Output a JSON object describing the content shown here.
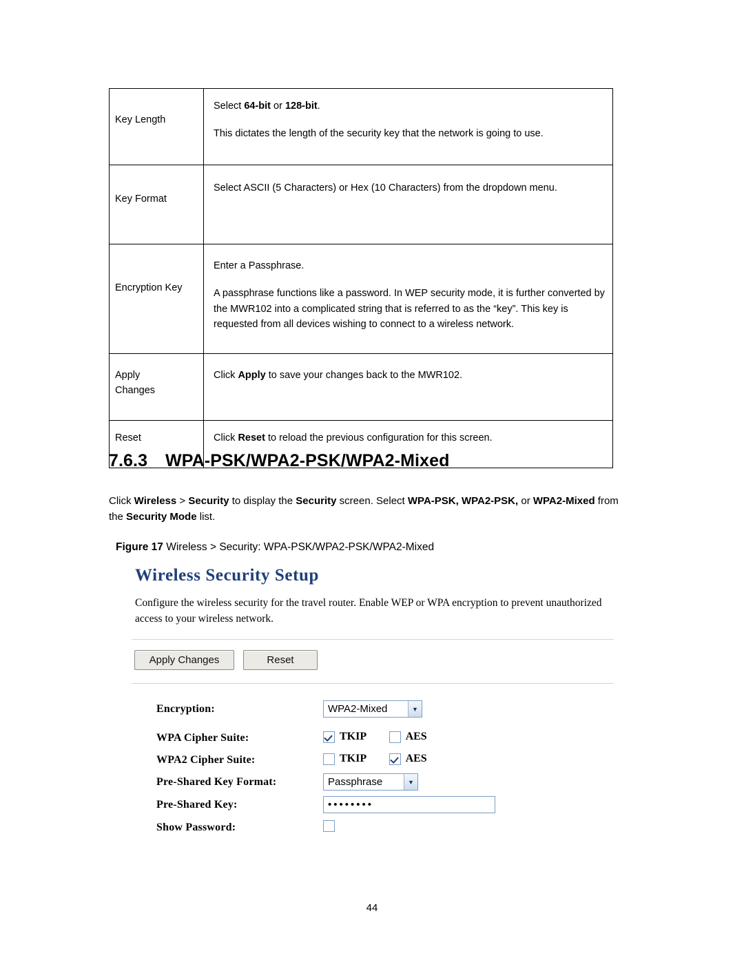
{
  "table": {
    "rows": [
      {
        "label": "Key Length",
        "lines": [
          {
            "segments": [
              {
                "t": "Select ",
                "b": false
              },
              {
                "t": "64-bit",
                "b": true
              },
              {
                "t": " or ",
                "b": false
              },
              {
                "t": "128-bit",
                "b": true
              },
              {
                "t": ".",
                "b": false
              }
            ]
          },
          {
            "segments": [
              {
                "t": "This dictates the length of the security key that the network is going to use.",
                "b": false
              }
            ]
          }
        ]
      },
      {
        "label": "Key Format",
        "lines": [
          {
            "segments": [
              {
                "t": "Select ASCII (5 Characters) or Hex (10 Characters) from the dropdown menu.",
                "b": false
              }
            ]
          }
        ]
      },
      {
        "label": "Encryption Key",
        "lines": [
          {
            "segments": [
              {
                "t": "Enter a Passphrase.",
                "b": false
              }
            ]
          },
          {
            "segments": [
              {
                "t": "A passphrase functions like a password. In WEP security mode, it is further converted by the MWR102 into a complicated string that is referred to as the “key”. This key is requested from all devices wishing to connect to a wireless network.",
                "b": false
              }
            ]
          }
        ]
      },
      {
        "label": "Apply Changes",
        "lines": [
          {
            "segments": [
              {
                "t": "Click ",
                "b": false
              },
              {
                "t": "Apply",
                "b": true
              },
              {
                "t": " to save your changes back to the MWR102.",
                "b": false
              }
            ]
          }
        ]
      },
      {
        "label": "Reset",
        "lines": [
          {
            "segments": [
              {
                "t": "Click ",
                "b": false
              },
              {
                "t": "Reset",
                "b": true
              },
              {
                "t": " to reload the previous configuration for this screen.",
                "b": false
              }
            ]
          }
        ]
      }
    ]
  },
  "heading": {
    "number": "7.6.3",
    "text": "WPA-PSK/WPA2-PSK/WPA2-Mixed"
  },
  "paragraph": {
    "segments": [
      {
        "t": "Click ",
        "b": false
      },
      {
        "t": "Wireless",
        "b": true
      },
      {
        "t": " > ",
        "b": false
      },
      {
        "t": "Security",
        "b": true
      },
      {
        "t": " to display the ",
        "b": false
      },
      {
        "t": "Security",
        "b": true
      },
      {
        "t": " screen. Select ",
        "b": false
      },
      {
        "t": "WPA-PSK, WPA2-PSK,",
        "b": true
      },
      {
        "t": " or ",
        "b": false
      },
      {
        "t": "WPA2-Mixed",
        "b": true
      },
      {
        "t": " from the ",
        "b": false
      },
      {
        "t": "Security Mode",
        "b": true
      },
      {
        "t": " list.",
        "b": false
      }
    ]
  },
  "figure": {
    "label": "Figure 17",
    "caption": "Wireless > Security: WPA-PSK/WPA2-PSK/WPA2-Mixed"
  },
  "screenshot": {
    "title": "Wireless Security Setup",
    "description": "Configure the wireless security for the travel router. Enable WEP or WPA encryption to prevent unauthorized access to your wireless network.",
    "buttons": {
      "apply": "Apply Changes",
      "reset": "Reset"
    },
    "fields": {
      "encryption_label": "Encryption:",
      "encryption_value": "WPA2-Mixed",
      "wpa_cipher_label": "WPA Cipher Suite:",
      "wpa_tkip_label": "TKIP",
      "wpa_aes_label": "AES",
      "wpa2_cipher_label": "WPA2 Cipher Suite:",
      "wpa2_tkip_label": "TKIP",
      "wpa2_aes_label": "AES",
      "psk_format_label": "Pre-Shared Key Format:",
      "psk_format_value": "Passphrase",
      "psk_label": "Pre-Shared Key:",
      "psk_value": "••••••••",
      "show_password_label": "Show Password:"
    },
    "checkbox_states": {
      "wpa_tkip": true,
      "wpa_aes": false,
      "wpa2_tkip": false,
      "wpa2_aes": true,
      "show_password": false
    },
    "colors": {
      "title": "#1f3f7a",
      "control_border": "#7a9cc6"
    }
  },
  "page_number": "44"
}
